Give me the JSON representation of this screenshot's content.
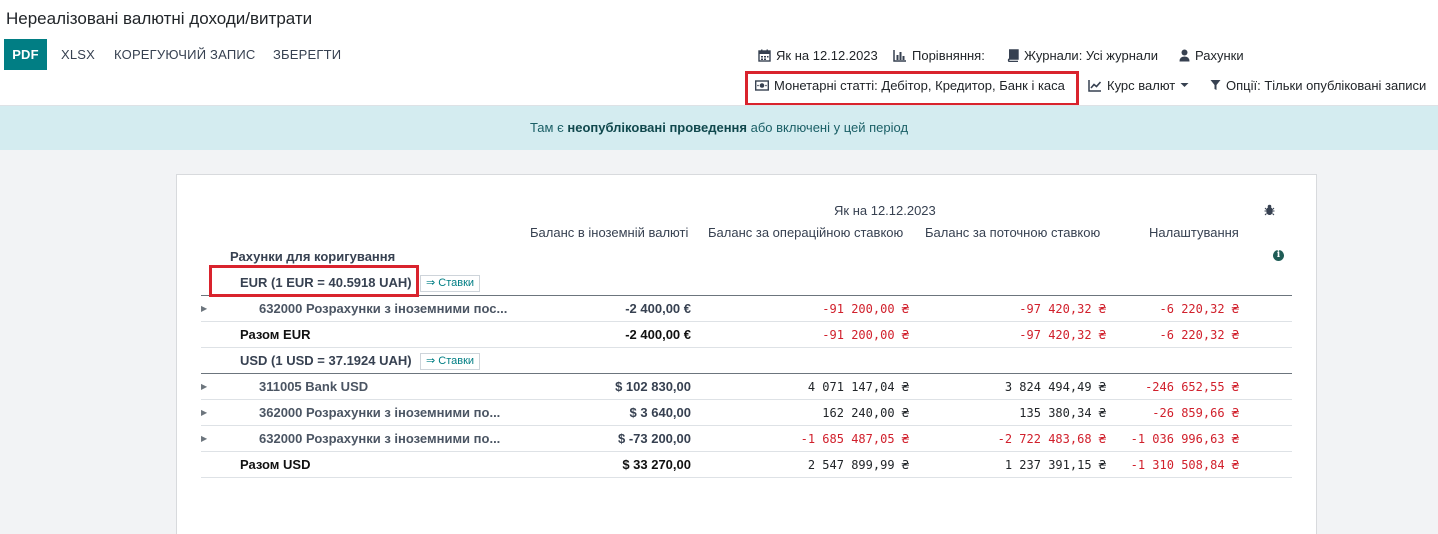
{
  "title": "Нереалізовані валютні доходи/витрати",
  "toolbar": {
    "pdf": "PDF",
    "xlsx": "XLSX",
    "correction": "КОРЕГУЮЧИЙ ЗАПИС",
    "save": "ЗБЕРЕГТИ"
  },
  "filters": {
    "date": "Як на 12.12.2023",
    "comparison": "Порівняння:",
    "journals": "Журнали: Усі журнали",
    "accounts": "Рахунки",
    "monetary": "Монетарні статті: Дебітор, Кредитор, Банк і каса",
    "rates": "Курс валют",
    "options": "Опції: Тільки опубліковані записи"
  },
  "banner": {
    "prefix": "Там є",
    "link": "неопубліковані проведення",
    "suffix": "або включені у цей період"
  },
  "report": {
    "date_header": "Як на 12.12.2023",
    "columns": [
      "Баланс в іноземній валюті",
      "Баланс за операційною ставкою",
      "Баланс за поточною ставкою",
      "Налаштування"
    ],
    "accounts_header": "Рахунки для коригування",
    "rates_label": "⇒ Ставки",
    "eur": {
      "group": "EUR (1 EUR = 40.5918 UAH)",
      "lines": [
        {
          "name": "632000 Розрахунки з іноземними пос...",
          "fc": "-2 400,00 €",
          "op": "-91 200,00 ₴",
          "cur": "-97 420,32 ₴",
          "adj": "-6 220,32 ₴"
        }
      ],
      "total": {
        "name": "Разом EUR",
        "fc": "-2 400,00 €",
        "op": "-91 200,00 ₴",
        "cur": "-97 420,32 ₴",
        "adj": "-6 220,32 ₴"
      }
    },
    "usd": {
      "group": "USD (1 USD = 37.1924 UAH)",
      "lines": [
        {
          "name": "311005 Bank USD",
          "fc": "$ 102 830,00",
          "op": "4 071 147,04 ₴",
          "cur": "3 824 494,49 ₴",
          "adj": "-246 652,55 ₴"
        },
        {
          "name": "362000 Розрахунки з іноземними по...",
          "fc": "$ 3 640,00",
          "op": "162 240,00 ₴",
          "cur": "135 380,34 ₴",
          "adj": "-26 859,66 ₴"
        },
        {
          "name": "632000 Розрахунки з іноземними по...",
          "fc": "$ -73 200,00",
          "op": "-1 685 487,05 ₴",
          "cur": "-2 722 483,68 ₴",
          "adj": "-1 036 996,63 ₴"
        }
      ],
      "total": {
        "name": "Разом USD",
        "fc": "$ 33 270,00",
        "op": "2 547 899,99 ₴",
        "cur": "1 237 391,15 ₴",
        "adj": "-1 310 508,84 ₴"
      }
    }
  },
  "colors": {
    "accent": "#017e84",
    "negative": "#d1202c",
    "highlight": "#d9232d",
    "banner_bg": "#d4ecf0"
  }
}
